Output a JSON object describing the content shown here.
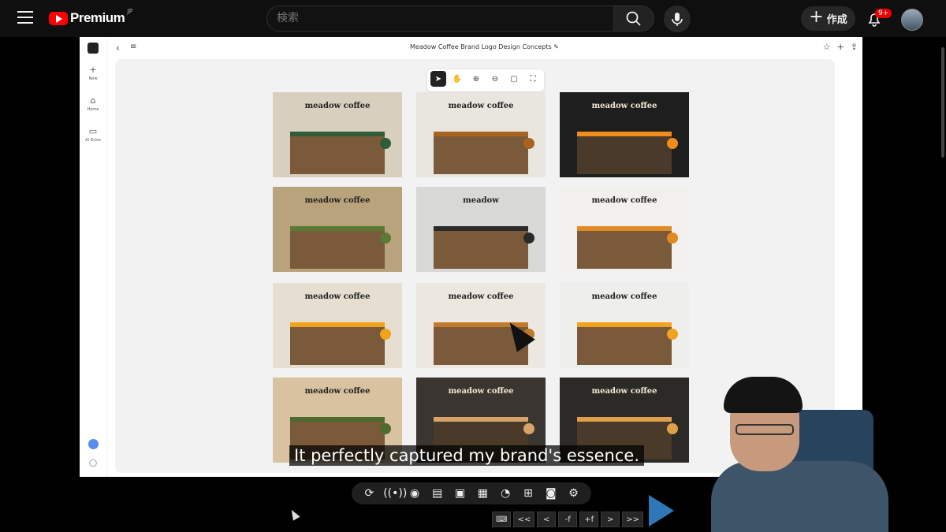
{
  "youtube": {
    "brand": "Premium",
    "region": "JP",
    "search_placeholder": "検索",
    "create_label": "作成",
    "notification_badge": "9+"
  },
  "app": {
    "doc_title": "Meadow Coffee Brand Logo Design Concepts",
    "rail": [
      {
        "icon": "plus-icon",
        "label": "New"
      },
      {
        "icon": "home-icon",
        "label": "Home"
      },
      {
        "icon": "folder-icon",
        "label": "AI Drive"
      }
    ],
    "toolbar": [
      "select-tool",
      "hand-tool",
      "zoom-in-tool",
      "zoom-out-tool",
      "fit-tool",
      "fullscreen-tool"
    ],
    "tiles": [
      {
        "sign": "meadow coffee",
        "bg": "#d9cfbf",
        "accent": "#2f5d3a"
      },
      {
        "sign": "meadow coffee",
        "bg": "#e9e6e0",
        "accent": "#a8641f"
      },
      {
        "sign": "meadow coffee",
        "bg": "#1e1e1e",
        "accent": "#f08c1c"
      },
      {
        "sign": "meadow coffee",
        "bg": "#b9a37d",
        "accent": "#5a7a35"
      },
      {
        "sign": "meadow",
        "bg": "#d8d8d6",
        "accent": "#2a2a2a"
      },
      {
        "sign": "meadow coffee",
        "bg": "#f2f0ec",
        "accent": "#e08a24"
      },
      {
        "sign": "meadow coffee",
        "bg": "#e6ded0",
        "accent": "#f0a31b"
      },
      {
        "sign": "meadow coffee",
        "bg": "#ece8e0",
        "accent": "#c07a2a"
      },
      {
        "sign": "meadow coffee",
        "bg": "#eeeeec",
        "accent": "#f0a31b"
      },
      {
        "sign": "meadow coffee",
        "bg": "#d8c2a0",
        "accent": "#4c6b2f"
      },
      {
        "sign": "meadow coffee",
        "bg": "#3a3530",
        "accent": "#d8a36a"
      },
      {
        "sign": "meadow coffee",
        "bg": "#2b2a27",
        "accent": "#e0a04a"
      }
    ]
  },
  "caption": "It perfectly captured my brand's essence.",
  "player_controls": [
    "loop-icon",
    "broadcast-icon",
    "preview-icon",
    "clapper-icon",
    "frame-icon",
    "filmstrip-icon",
    "speed-icon",
    "add-icon",
    "camera-icon",
    "settings-icon"
  ],
  "frame_controls": [
    "<<",
    "<",
    "-f",
    "+f",
    ">",
    ">>"
  ]
}
